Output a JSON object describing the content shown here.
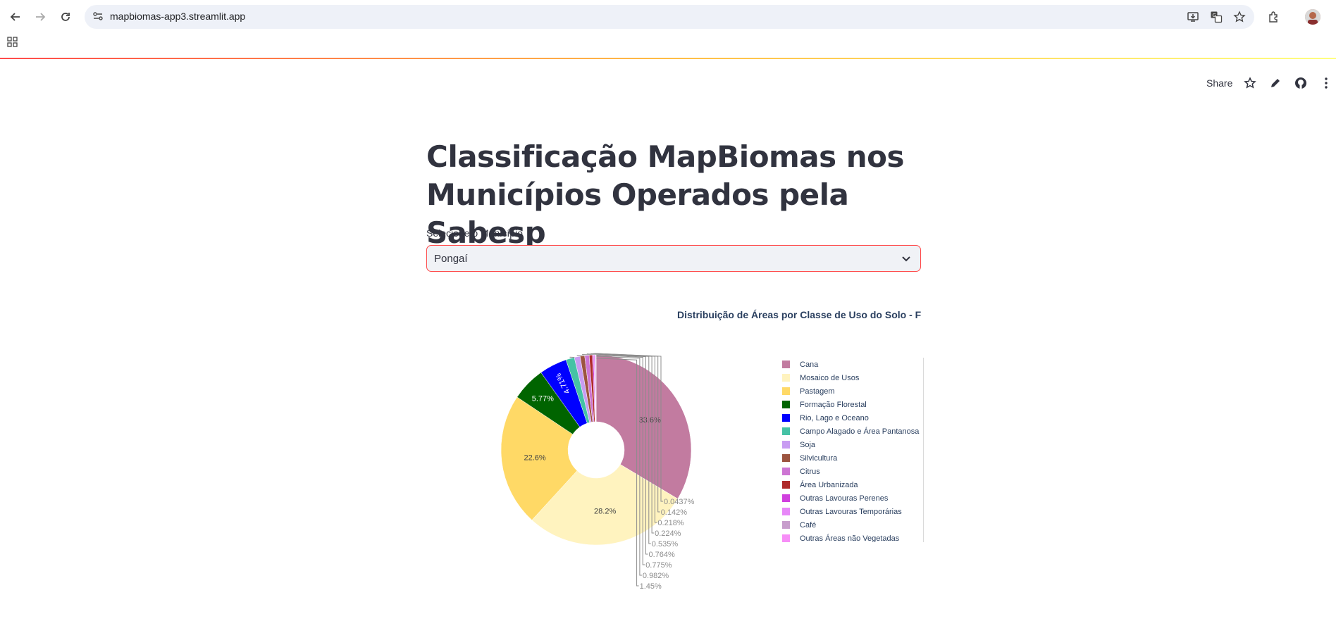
{
  "browser": {
    "url": "mapbiomas-app3.streamlit.app"
  },
  "toolbar": {
    "share_label": "Share"
  },
  "page": {
    "title_line1": "Classificação MapBiomas nos",
    "title_line2": "Municípios Operados pela Sabesp",
    "select_label": "Selecione o Município",
    "select_value": "Pongaí"
  },
  "chart_data": {
    "type": "pie",
    "hole": true,
    "title": "Distribuição de Áreas por Classe de Uso do Solo - F",
    "categories": [
      "Cana",
      "Mosaico de Usos",
      "Pastagem",
      "Formação Florestal",
      "Rio, Lago e Oceano",
      "Campo Alagado e Área Pantanosa",
      "Soja",
      "Silvicultura",
      "Citrus",
      "Área Urbanizada",
      "Outras Lavouras Perenes",
      "Outras Lavouras Temporárias",
      "Café",
      "Outras Áreas não Vegetadas"
    ],
    "values": [
      33.6,
      28.2,
      22.6,
      5.77,
      4.71,
      1.45,
      0.982,
      0.775,
      0.764,
      0.535,
      0.224,
      0.218,
      0.142,
      0.0437
    ],
    "labels": [
      "33.6%",
      "28.2%",
      "22.6%",
      "5.77%",
      "4.71%",
      "1.45%",
      "0.982%",
      "0.775%",
      "0.764%",
      "0.535%",
      "0.224%",
      "0.218%",
      "0.142%",
      "0.0437%"
    ],
    "colors": [
      "#c27ba0",
      "#fff3bf",
      "#ffd966",
      "#006400",
      "#0000ff",
      "#45c2a5",
      "#c89cf2",
      "#9c543f",
      "#cd75d3",
      "#af2a2a",
      "#d040de",
      "#e787f8",
      "#c79dcc",
      "#f78ef7"
    ],
    "legend_position": "right"
  }
}
